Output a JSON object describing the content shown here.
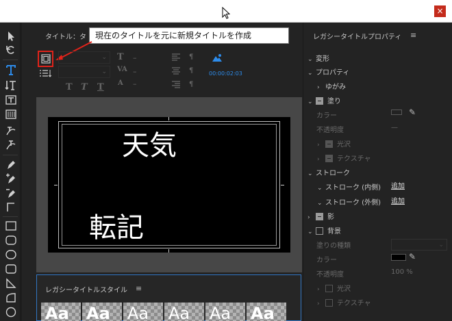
{
  "window": {
    "close_glyph": "×"
  },
  "toolbar": {
    "tools": [
      {
        "name": "selection-tool"
      },
      {
        "name": "rotate-tool"
      },
      {
        "name": "type-tool"
      },
      {
        "name": "vertical-type-tool"
      },
      {
        "name": "area-type-tool"
      },
      {
        "name": "vertical-area-type-tool"
      },
      {
        "name": "path-type-tool"
      },
      {
        "name": "vertical-path-type-tool"
      },
      {
        "name": "pen-tool"
      },
      {
        "name": "add-anchor-tool"
      },
      {
        "name": "delete-anchor-tool"
      },
      {
        "name": "convert-anchor-tool"
      },
      {
        "name": "rectangle-tool"
      },
      {
        "name": "rounded-rectangle-tool"
      },
      {
        "name": "clipped-corner-tool"
      },
      {
        "name": "rounded-corner-tool"
      },
      {
        "name": "wedge-tool"
      },
      {
        "name": "arc-tool"
      },
      {
        "name": "ellipse-tool"
      }
    ]
  },
  "designer": {
    "tab_label": "タイトル：タ",
    "callout_text": "現在のタイトルを元に新規タイトルを作成",
    "timecode": "00:00:02:03",
    "dash": "–",
    "canvas": {
      "line1": "天気",
      "line2": "転記"
    }
  },
  "styles_panel": {
    "title": "レガシータイトルスタイル",
    "menu_glyph": "≡",
    "swatches": [
      "Aa",
      "Aa",
      "Aa",
      "Aa",
      "Aa",
      "Aa"
    ]
  },
  "properties": {
    "title": "レガシータイトルプロパティ",
    "menu_glyph": "≡",
    "transform": "変形",
    "props_section": "プロパティ",
    "distort": "ゆがみ",
    "fill": "塗り",
    "color": "カラー",
    "opacity": "不透明度",
    "sheen": "光沢",
    "texture": "テクスチャ",
    "strokes": "ストローク",
    "inner_strokes": "ストローク (内側)",
    "outer_strokes": "ストローク (外側)",
    "add": "追加",
    "shadow": "影",
    "background": "背景",
    "fill_type": "塗りの種類",
    "bg_color": "カラー",
    "bg_opacity": "不透明度",
    "bg_opacity_value": "100 %",
    "bg_sheen": "光沢",
    "bg_texture": "テクスチャ",
    "fill_dash": "—",
    "bg_color_hex": "#000000"
  }
}
